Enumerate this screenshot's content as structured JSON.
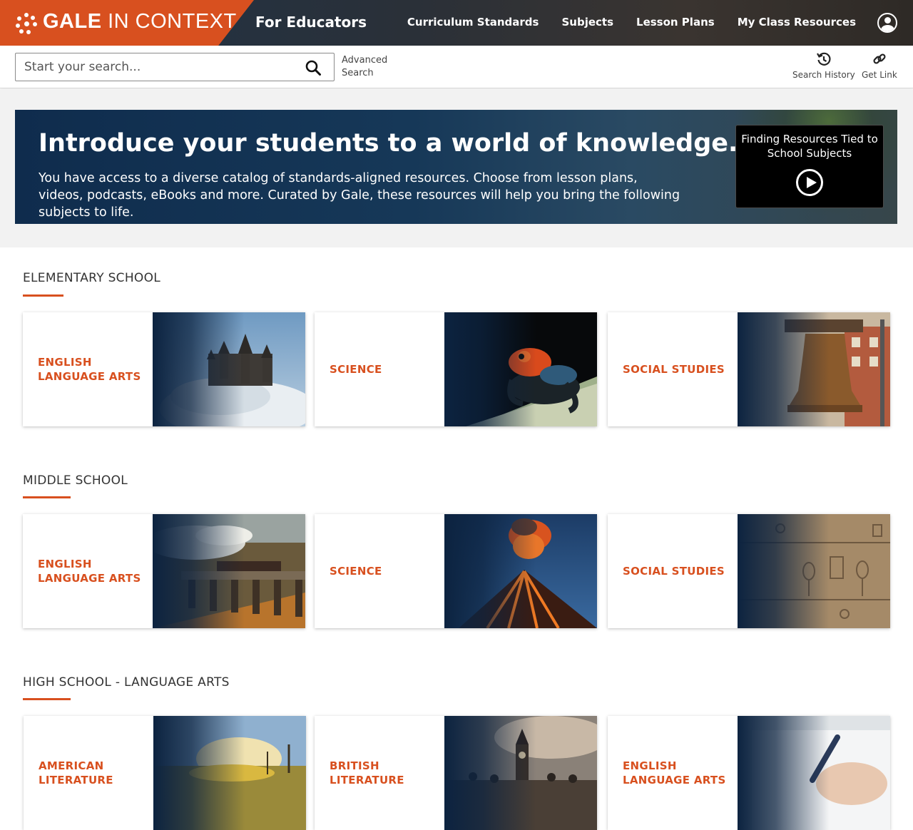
{
  "header": {
    "brand_bold": "GALE",
    "brand_light": " IN CONTEXT",
    "subtitle": "For Educators",
    "nav": [
      {
        "label": "Curriculum Standards"
      },
      {
        "label": "Subjects"
      },
      {
        "label": "Lesson Plans"
      },
      {
        "label": "My Class Resources"
      }
    ],
    "colors": {
      "brand_orange": "#d8501f",
      "nav_dark": "#2a3038"
    }
  },
  "search": {
    "placeholder": "Start your search...",
    "value": "",
    "advanced_line1": "Advanced",
    "advanced_line2": "Search",
    "tools": [
      {
        "label": "Search History",
        "icon": "history-icon"
      },
      {
        "label": "Get Link",
        "icon": "link-icon"
      }
    ]
  },
  "hero": {
    "title": "Introduce your students to a world of knowledge.",
    "description": "You have access to a diverse catalog of standards-aligned resources. Choose from lesson plans, videos, podcasts, eBooks and more. Curated by Gale, these resources will help you bring the following subjects to life.",
    "video_title": "Finding Resources Tied to School Subjects",
    "video_icon": "play-circle-icon"
  },
  "sections": [
    {
      "title": "ELEMENTARY SCHOOL",
      "cards": [
        {
          "label": "ENGLISH LANGUAGE ARTS",
          "image": "castle-image"
        },
        {
          "label": "SCIENCE",
          "image": "frog-image"
        },
        {
          "label": "SOCIAL STUDIES",
          "image": "liberty-bell-image"
        }
      ]
    },
    {
      "title": "MIDDLE SCHOOL",
      "cards": [
        {
          "label": "ENGLISH LANGUAGE ARTS",
          "image": "steam-train-image"
        },
        {
          "label": "SCIENCE",
          "image": "volcano-image"
        },
        {
          "label": "SOCIAL STUDIES",
          "image": "hieroglyphs-image"
        }
      ]
    },
    {
      "title": "HIGH SCHOOL - LANGUAGE ARTS",
      "cards": [
        {
          "label": "AMERICAN LITERATURE",
          "image": "countryside-image"
        },
        {
          "label": "BRITISH LITERATURE",
          "image": "big-ben-image"
        },
        {
          "label": "ENGLISH LANGUAGE ARTS",
          "image": "writing-image"
        }
      ]
    }
  ]
}
